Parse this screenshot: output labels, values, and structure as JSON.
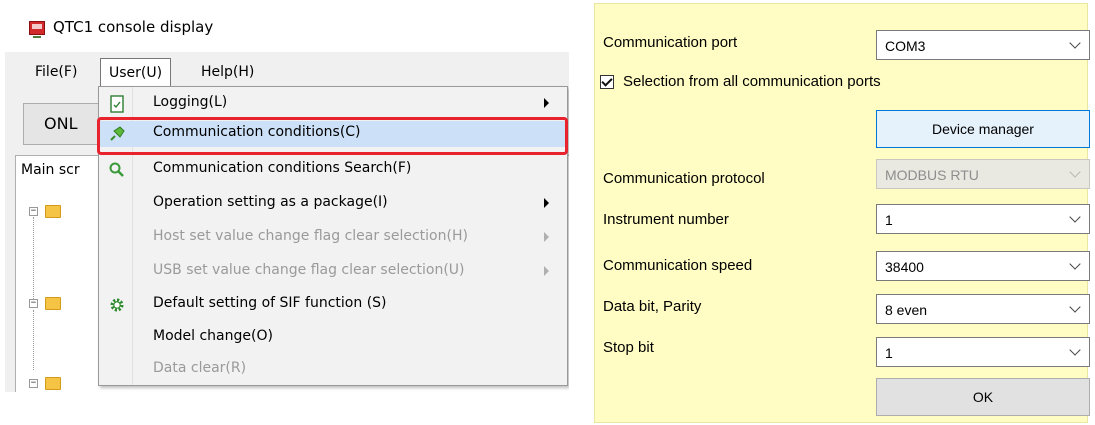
{
  "window": {
    "title": "QTC1 console display"
  },
  "menubar": {
    "file": "File(F)",
    "user": "User(U)",
    "help": "Help(H)"
  },
  "toolbar": {
    "online_label": "ONL"
  },
  "main": {
    "screen_label": "Main scr"
  },
  "user_menu": {
    "items": [
      {
        "label": "Logging(L)",
        "icon": "logging-icon",
        "submenu": true,
        "enabled": true
      },
      {
        "label": "Communication conditions(C)",
        "icon": "plug-icon",
        "submenu": false,
        "enabled": true,
        "selected": true
      },
      {
        "label": "Communication conditions Search(F)",
        "icon": "search-icon",
        "submenu": false,
        "enabled": true
      },
      {
        "label": "Operation setting as a package(I)",
        "icon": "",
        "submenu": true,
        "enabled": true
      },
      {
        "label": "Host set value change flag clear selection(H)",
        "icon": "",
        "submenu": true,
        "enabled": false
      },
      {
        "label": "USB set value change flag clear selection(U)",
        "icon": "",
        "submenu": true,
        "enabled": false
      },
      {
        "label": "Default setting of SIF function (S)",
        "icon": "gear-icon",
        "submenu": false,
        "enabled": true
      },
      {
        "label": "Model change(O)",
        "icon": "",
        "submenu": false,
        "enabled": true
      },
      {
        "label": "Data clear(R)",
        "icon": "",
        "submenu": false,
        "enabled": false
      }
    ]
  },
  "dialog": {
    "port_label": "Communication port",
    "port_value": "COM3",
    "all_ports_label": "Selection from all communication ports",
    "all_ports_checked": true,
    "device_manager": "Device manager",
    "protocol_label": "Communication protocol",
    "protocol_value": "MODBUS RTU",
    "instrument_label": "Instrument number",
    "instrument_value": "1",
    "speed_label": "Communication speed",
    "speed_value": "38400",
    "databit_label": "Data bit, Parity",
    "databit_value": "8 even",
    "stopbit_label": "Stop bit",
    "stopbit_value": "1",
    "ok": "OK"
  },
  "colors": {
    "highlight_outline": "#e8232e",
    "selection_bg": "#cce0f7",
    "dialog_bg": "#fffdc4"
  }
}
